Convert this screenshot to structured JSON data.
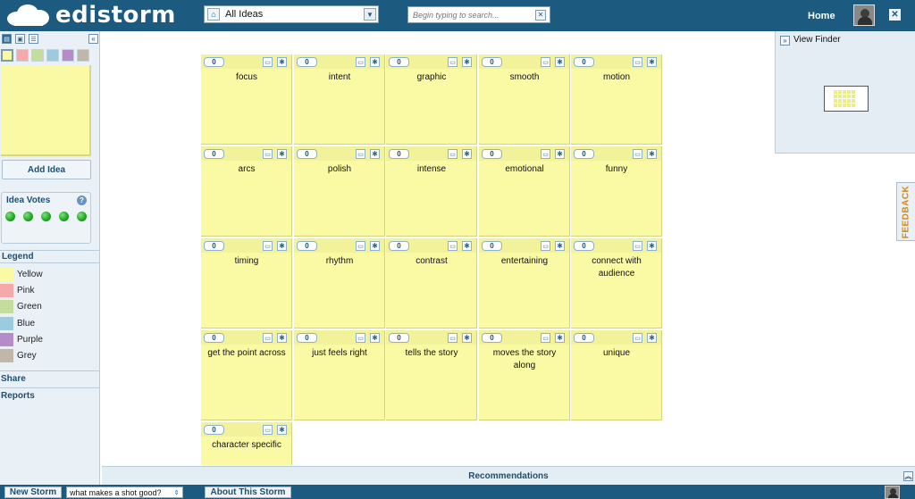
{
  "app": {
    "logo_text": "edistorm",
    "home_label": "Home",
    "close_label": "✕"
  },
  "header": {
    "ideas_filter": "All Ideas",
    "search_placeholder": "Begin typing to search..."
  },
  "sidebar": {
    "tools": [
      "note-tool-icon",
      "image-tool-icon",
      "list-tool-icon"
    ],
    "colors": [
      "#fafaa4",
      "#f7a8a8",
      "#c4dc9c",
      "#9ccbe0",
      "#b38cc9",
      "#c0b6aa"
    ],
    "add_idea_label": "Add Idea",
    "idea_votes_title": "Idea Votes",
    "idea_votes_help": "?",
    "votes_remaining": 5,
    "legend_title": "Legend",
    "legend": [
      {
        "label": "Yellow",
        "color": "#fafaa4"
      },
      {
        "label": "Pink",
        "color": "#f7a8a8"
      },
      {
        "label": "Green",
        "color": "#c4dc9c"
      },
      {
        "label": "Blue",
        "color": "#9ccbe0"
      },
      {
        "label": "Purple",
        "color": "#b38cc9"
      },
      {
        "label": "Grey",
        "color": "#c0b6aa"
      }
    ],
    "share_label": "Share",
    "reports_label": "Reports"
  },
  "board": {
    "notes": [
      {
        "text": "focus",
        "votes": "0"
      },
      {
        "text": "intent",
        "votes": "0"
      },
      {
        "text": "graphic",
        "votes": "0"
      },
      {
        "text": "smooth",
        "votes": "0"
      },
      {
        "text": "motion",
        "votes": "0"
      },
      {
        "text": "arcs",
        "votes": "0"
      },
      {
        "text": "polish",
        "votes": "0"
      },
      {
        "text": "intense",
        "votes": "0"
      },
      {
        "text": "emotional",
        "votes": "0"
      },
      {
        "text": "funny",
        "votes": "0"
      },
      {
        "text": "timing",
        "votes": "0"
      },
      {
        "text": "rhythm",
        "votes": "0"
      },
      {
        "text": "contrast",
        "votes": "0"
      },
      {
        "text": "entertaining",
        "votes": "0"
      },
      {
        "text": "connect with audience",
        "votes": "0"
      },
      {
        "text": "get the point across",
        "votes": "0"
      },
      {
        "text": "just feels right",
        "votes": "0"
      },
      {
        "text": "tells the story",
        "votes": "0"
      },
      {
        "text": "moves the story along",
        "votes": "0"
      },
      {
        "text": "unique",
        "votes": "0"
      },
      {
        "text": "character specific",
        "votes": "0"
      }
    ]
  },
  "view_finder": {
    "title": "View Finder"
  },
  "feedback_label": "FEEDBACK",
  "recommendations_label": "Recommendations",
  "footer": {
    "new_storm_label": "New Storm",
    "storm_select_value": "what makes a shot good?",
    "about_label": "About This Storm"
  }
}
